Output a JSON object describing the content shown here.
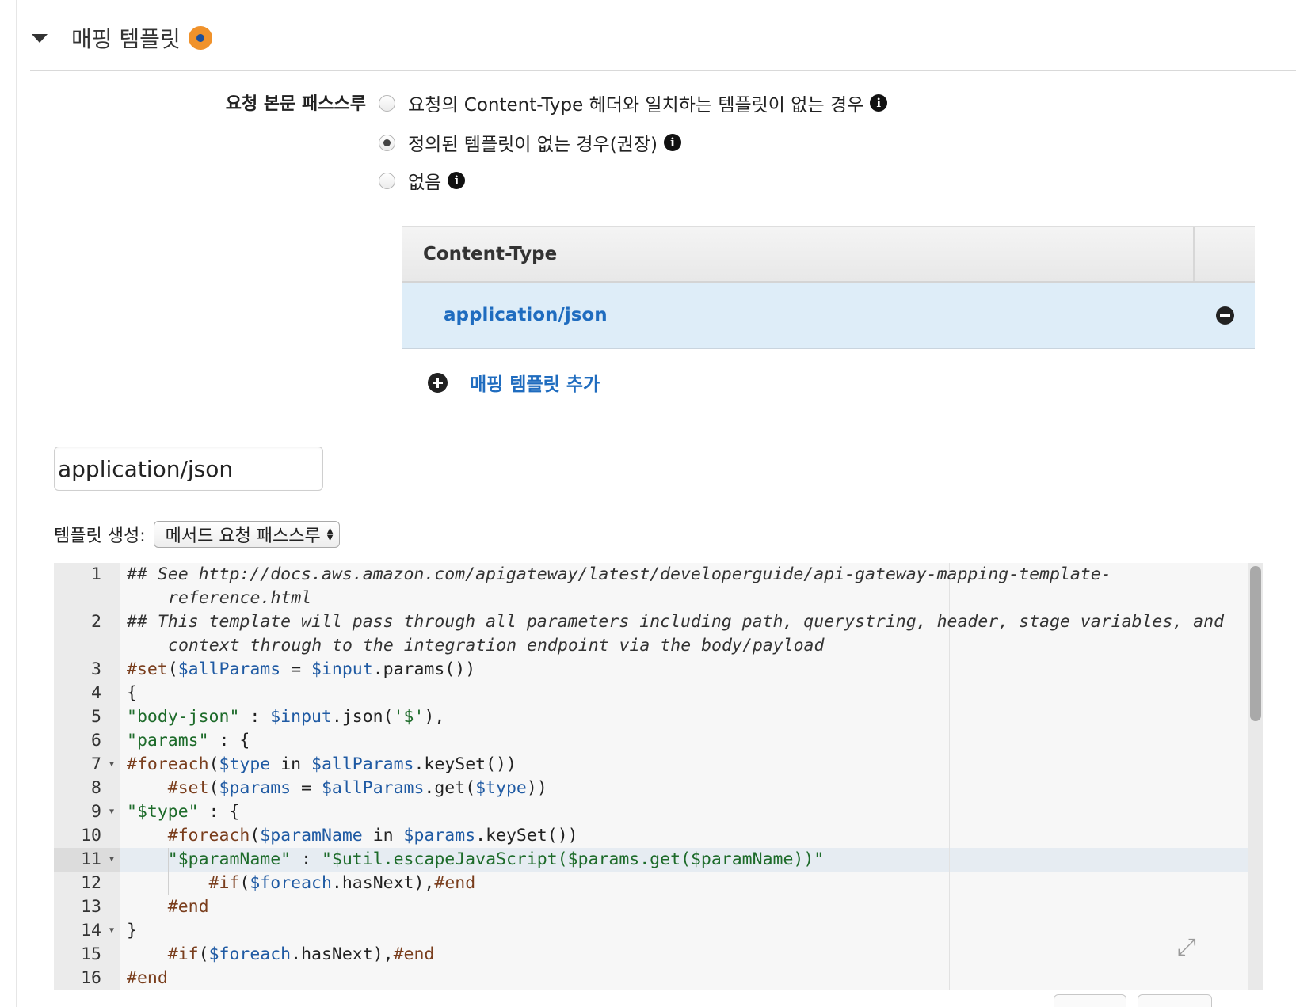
{
  "section": {
    "title": "매핑 템플릿",
    "status_color": "#f0922b"
  },
  "passthrough": {
    "label": "요청 본문 패스스루",
    "options": [
      {
        "label": "요청의 Content-Type 헤더와 일치하는 템플릿이 없는 경우",
        "selected": false
      },
      {
        "label": "정의된 템플릿이 없는 경우(권장)",
        "selected": true
      },
      {
        "label": "없음",
        "selected": false
      }
    ]
  },
  "content_type_table": {
    "header": "Content-Type",
    "rows": [
      {
        "value": "application/json",
        "selected": true
      }
    ],
    "add_label": "매핑 템플릿 추가"
  },
  "content_type_input": {
    "value": "application/json"
  },
  "generate_template": {
    "label": "템플릿 생성:",
    "selected": "메서드 요청 패스스루"
  },
  "editor": {
    "active_line": 11,
    "lines": [
      {
        "n": "1",
        "fold": false,
        "text": "##  See http://docs.aws.amazon.com/apigateway/latest/developerguide/api-gateway-mapping-template-reference.html"
      },
      {
        "n": "2",
        "fold": false,
        "text": "##  This template will pass through all parameters including path, querystring, header, stage variables, and context through to the integration endpoint via the body/payload"
      },
      {
        "n": "3",
        "fold": false,
        "text": "#set($allParams = $input.params())"
      },
      {
        "n": "4",
        "fold": false,
        "text": "{"
      },
      {
        "n": "5",
        "fold": false,
        "text": "\"body-json\" : $input.json('$'),"
      },
      {
        "n": "6",
        "fold": false,
        "text": "\"params\" : {"
      },
      {
        "n": "7",
        "fold": true,
        "text": "#foreach($type in $allParams.keySet())"
      },
      {
        "n": "8",
        "fold": false,
        "text": "    #set($params = $allParams.get($type))"
      },
      {
        "n": "9",
        "fold": true,
        "text": "\"$type\" : {"
      },
      {
        "n": "10",
        "fold": false,
        "text": "    #foreach($paramName in $params.keySet())"
      },
      {
        "n": "11",
        "fold": true,
        "text": "    \"$paramName\" : \"$util.escapeJavaScript($params.get($paramName))\""
      },
      {
        "n": "12",
        "fold": false,
        "text": "        #if($foreach.hasNext),#end"
      },
      {
        "n": "13",
        "fold": false,
        "text": "    #end"
      },
      {
        "n": "14",
        "fold": true,
        "text": "}"
      },
      {
        "n": "15",
        "fold": false,
        "text": "    #if($foreach.hasNext),#end"
      },
      {
        "n": "16",
        "fold": false,
        "text": "#end"
      }
    ]
  },
  "icons": {
    "info": "info-icon",
    "remove": "minus-circle-icon",
    "add": "plus-circle-icon",
    "expand": "expand-icon",
    "collapse": "caret-down-icon"
  }
}
